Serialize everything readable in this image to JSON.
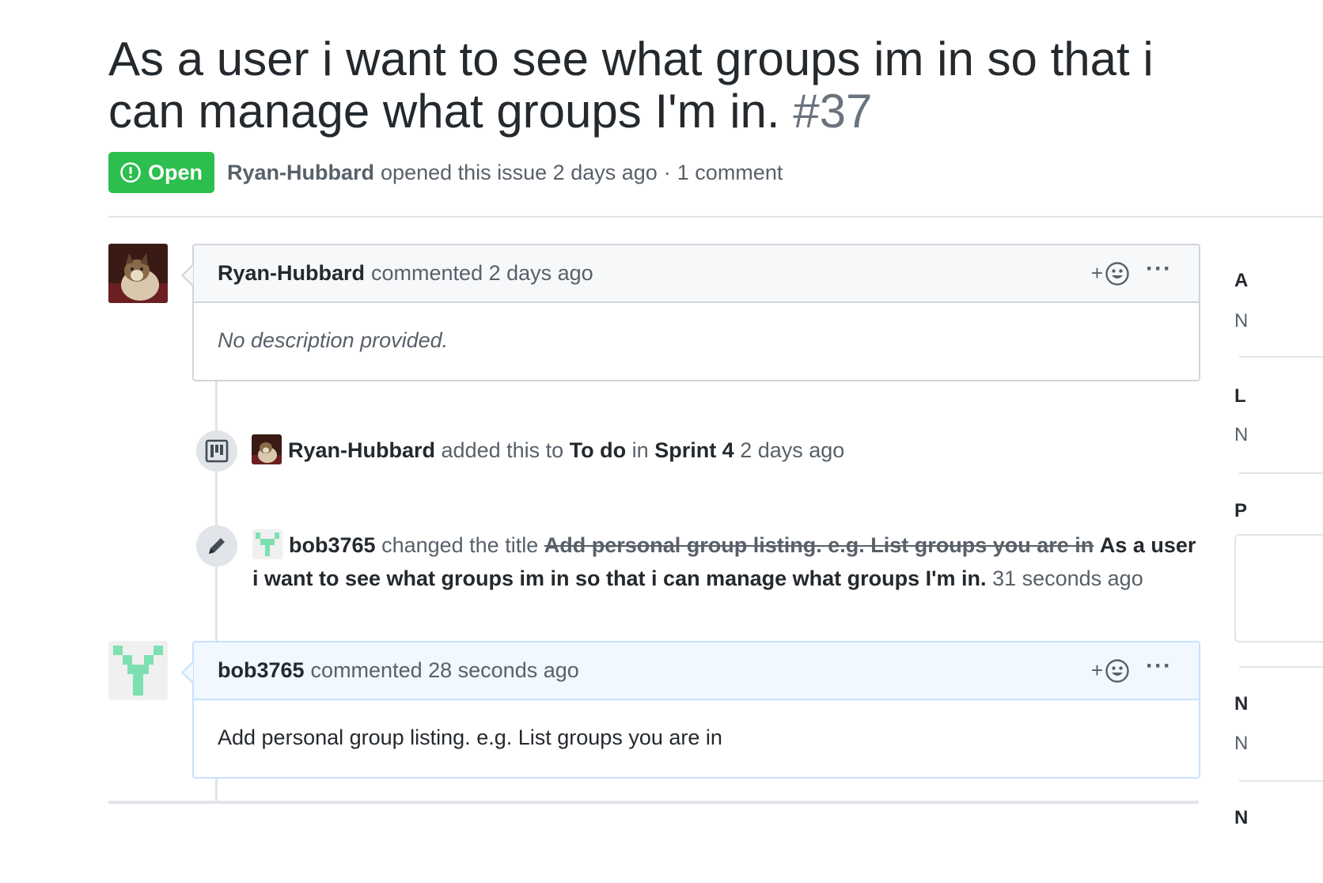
{
  "issue": {
    "title": "As a user i want to see what groups im in so that i can manage what groups I'm in.",
    "number": "#37",
    "state": "Open",
    "author": "Ryan-Hubbard",
    "opened_text": "opened this issue 2 days ago",
    "separator": "·",
    "comment_count": "1 comment"
  },
  "comments": [
    {
      "author": "Ryan-Hubbard",
      "action": "commented 2 days ago",
      "body": "No description provided."
    },
    {
      "author": "bob3765",
      "action": "commented 28 seconds ago",
      "body": "Add personal group listing. e.g. List groups you are in"
    }
  ],
  "events": {
    "project": {
      "actor": "Ryan-Hubbard",
      "text_added": "added this to",
      "column": "To do",
      "in_word": "in",
      "project": "Sprint 4",
      "time": "2 days ago"
    },
    "rename": {
      "actor": "bob3765",
      "text_changed": "changed the title",
      "old_title": "Add personal group listing. e.g. List groups you are in",
      "new_title": "As a user i want to see what groups im in so that i can manage what groups I'm in.",
      "time": "31 seconds ago"
    }
  },
  "actions": {
    "react_plus": "+",
    "more_dots": "···"
  },
  "sidebar_fragments": [
    "A",
    "N",
    "L",
    "N",
    "P",
    "N",
    "N",
    "N"
  ],
  "colors": {
    "open_green": "#2cbe4e",
    "identicon_green": "#7ee0b0",
    "border": "#d1d5da",
    "blue_border": "#c8e1ff"
  },
  "icons": {
    "state": "issue-opened-icon",
    "reaction": "smiley-icon",
    "project_event": "project-icon",
    "rename_event": "pencil-icon"
  }
}
